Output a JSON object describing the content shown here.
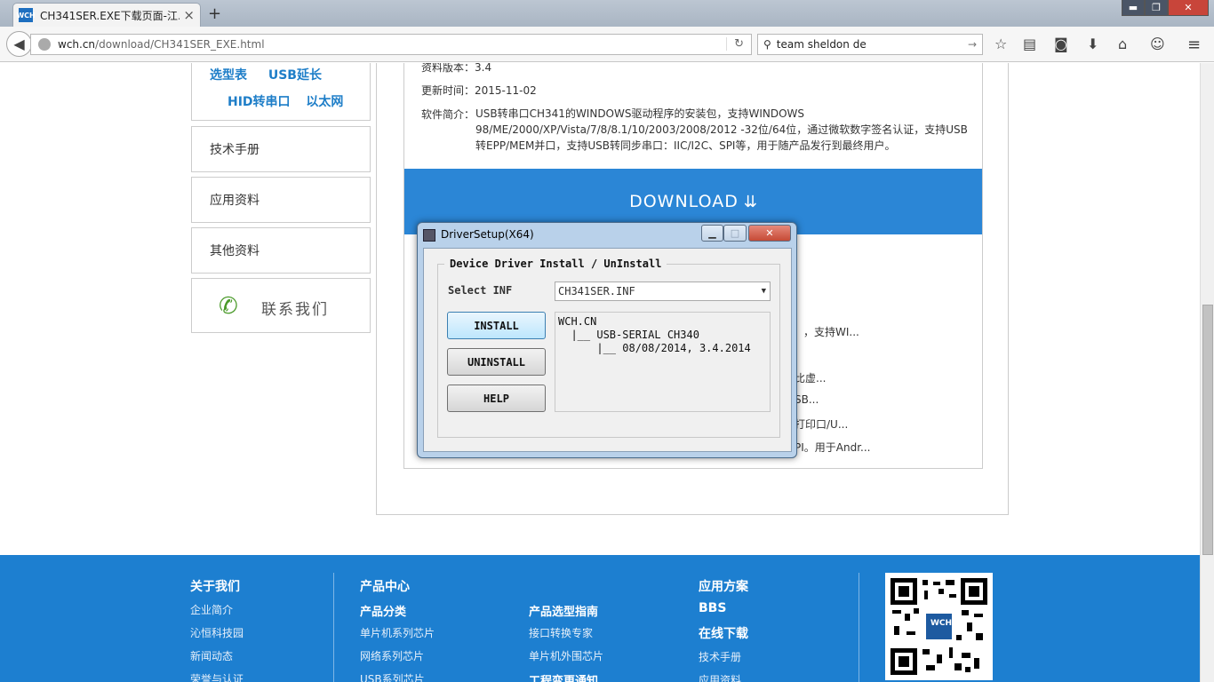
{
  "browser": {
    "tab_title": "CH341SER.EXE下载页面-江...",
    "tab_favicon": "WCH",
    "new_tab": "+",
    "close_tab": "×",
    "url_domain": "wch.cn",
    "url_path": "/download/CH341SER_EXE.html",
    "search_value": "team sheldon de",
    "window_min": "▬",
    "window_max": "❐",
    "window_close": "✕"
  },
  "sidebar": {
    "links_row1": [
      "选型表",
      "USB延长"
    ],
    "links_row2": [
      "HID转串口",
      "以太网"
    ],
    "items": [
      "技术手册",
      "应用资料",
      "其他资料"
    ],
    "contact": "联系我们"
  },
  "details": {
    "version_label": "资料版本：",
    "version_value": "3.4",
    "updated_label": "更新时间：",
    "updated_value": "2015-11-02",
    "summary_label": "软件简介：",
    "summary_value": "USB转串口CH341的WINDOWS驱动程序的安装包，支持WINDOWS 98/ME/2000/XP/Vista/7/8/8.1/10/2003/2008/2012 -32位/64位，通过微软数字签名认证，支持USB转EPP/MEM并口，支持USB转同步串口：IIC/I2C、SPI等，用于随产品发行到最终用户。",
    "download_label": "DOWNLOAD"
  },
  "related_peeks": [
    "，支持WI...",
    "比虚...",
    "SB...",
    "打印口/U...",
    "PI。用于Andr..."
  ],
  "dialog": {
    "title": "DriverSetup(X64)",
    "group_label": "Device Driver Install / UnInstall",
    "select_label": "Select INF",
    "select_value": "CH341SER.INF",
    "install": "INSTALL",
    "uninstall": "UNINSTALL",
    "help": "HELP",
    "tree": "WCH.CN\n  |__ USB-SERIAL CH340\n      |__ 08/08/2014, 3.4.2014"
  },
  "footer": {
    "col1_head": "关于我们",
    "col1_links": [
      "企业简介",
      "沁恒科技园",
      "新闻动态",
      "荣誉与认证"
    ],
    "col2_head": "产品中心",
    "col2_sub": "产品分类",
    "col2_links": [
      "单片机系列芯片",
      "网络系列芯片",
      "USB系列芯片"
    ],
    "col3_sub": "产品选型指南",
    "col3_links": [
      "接口转换专家",
      "单片机外围芯片"
    ],
    "col3_sub2": "工程变更通知",
    "col4_head": "应用方案",
    "col4_bbs": "BBS",
    "col4_dl": "在线下载",
    "col4_links": [
      "技术手册",
      "应用资料"
    ],
    "qr_center": "WCH"
  }
}
